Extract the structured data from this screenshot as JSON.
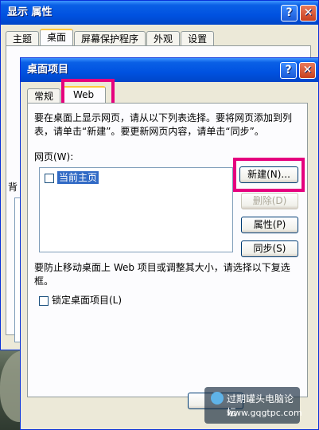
{
  "back_window": {
    "title": "显示 属性",
    "tabs": [
      "主题",
      "桌面",
      "屏幕保护程序",
      "外观",
      "设置"
    ],
    "active_tab_index": 1,
    "side_labels": [
      "背",
      "(",
      "("
    ]
  },
  "dialog": {
    "title": "桌面项目",
    "tabs": [
      "常规",
      "Web"
    ],
    "active_tab": "Web",
    "instructions": "要在桌面上显示网页，请从以下列表选择。要将网页添加到列表，请单击“新建”。要更新网页内容，请单击“同步”。",
    "list_label": "网页(W):",
    "list_items": [
      {
        "label": "当前主页",
        "checked": false,
        "selected": true
      }
    ],
    "buttons": {
      "new": "新建(N)...",
      "delete": "删除(D)",
      "properties": "属性(P)",
      "sync": "同步(S)"
    },
    "lock_note": "要防止移动桌面上 Web 项目或调整其大小，请选择以下复选框。",
    "lock_checkbox": "锁定桌面项目(L)",
    "lock_checked": false
  },
  "watermark": {
    "site_name": "过期罐头电脑论坛",
    "url": "www.gqgtpc.com"
  },
  "colors": {
    "highlight": "#e5007e",
    "titlebar": "#0052e0",
    "dialog_bg": "#ece9d8"
  }
}
